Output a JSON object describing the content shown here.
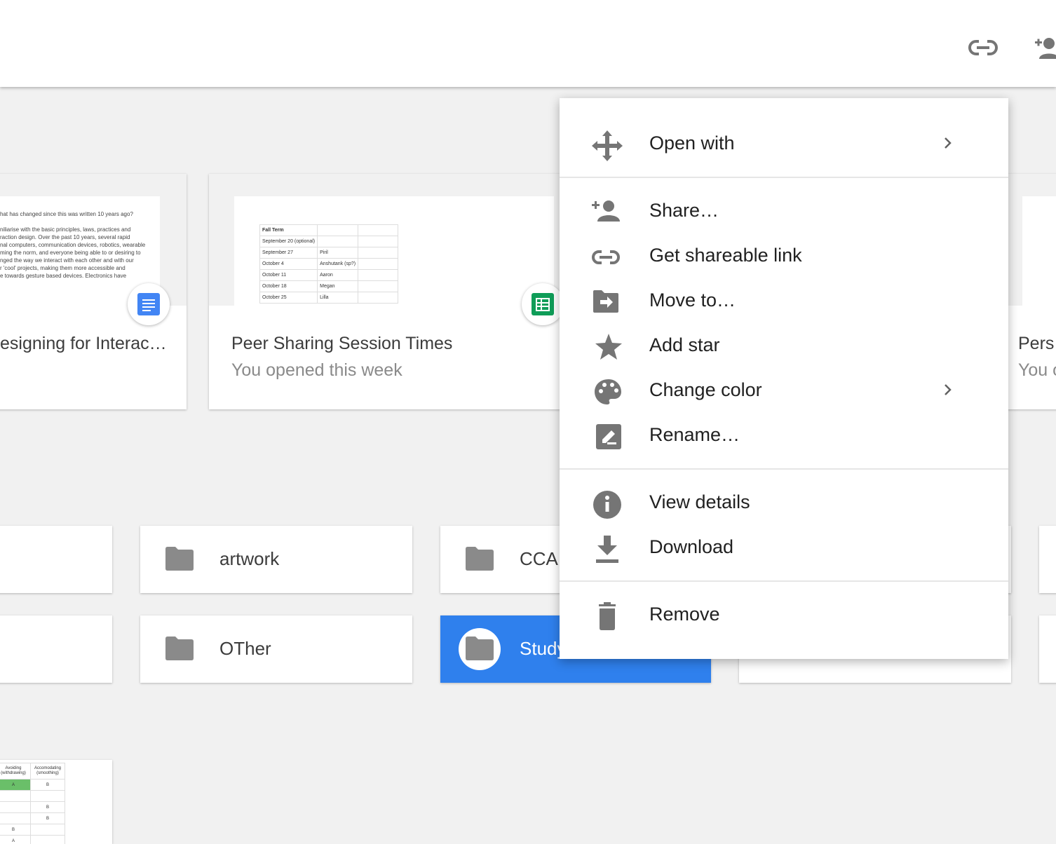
{
  "menu": {
    "open_with": "Open with",
    "share": "Share…",
    "get_link": "Get shareable link",
    "move_to": "Move to…",
    "add_star": "Add star",
    "change_color": "Change color",
    "rename": "Rename…",
    "view_details": "View details",
    "download": "Download",
    "remove": "Remove"
  },
  "quick_access": [
    {
      "title": "esigning for Interac…",
      "doc_lines": [
        "hat has changed since this was written 10 years ago?",
        "",
        "niliarise with the basic principles, laws, practices and",
        "raction design. Over the past 10 years, several rapid",
        "nal computers, communication devices, robotics, wearable",
        "ming the norm, and everyone being able to or desiring to",
        "nged the way we interact with each other and with our",
        "r 'cool' projects, making them more accessible and",
        "e towards gesture based devices. Electronics have"
      ]
    },
    {
      "title": "Peer Sharing Session Times",
      "subtitle": "You opened this week",
      "sheet_rows": [
        [
          "Fall Term",
          "",
          ""
        ],
        [
          "September 20  (optional)",
          "",
          ""
        ],
        [
          "September 27",
          "Piril",
          ""
        ],
        [
          "October 4",
          "Anshutank (sp?)",
          ""
        ],
        [
          "October 11",
          "Aaron",
          ""
        ],
        [
          "October 18",
          "Megan",
          ""
        ],
        [
          "October 25",
          "Lilla",
          ""
        ]
      ]
    },
    {
      "title": "Pers",
      "subtitle": "You o"
    }
  ],
  "folders": {
    "artwork": "artwork",
    "cca": "CCA",
    "other": "OTher",
    "study": "Study"
  },
  "bottom_sheet": {
    "headers": [
      "Avoiding (withdrawing)",
      "Accomodating (smoothing)"
    ],
    "rows": [
      [
        "A",
        "B"
      ],
      [
        "",
        ""
      ],
      [
        "",
        "B"
      ],
      [
        "",
        "B"
      ],
      [
        "B",
        ""
      ],
      [
        "A",
        ""
      ]
    ]
  },
  "colors": {
    "selected_folder": "#2f80ed",
    "docs_blue": "#4285f4",
    "sheets_green": "#0f9d58",
    "icon_grey": "#757575"
  }
}
